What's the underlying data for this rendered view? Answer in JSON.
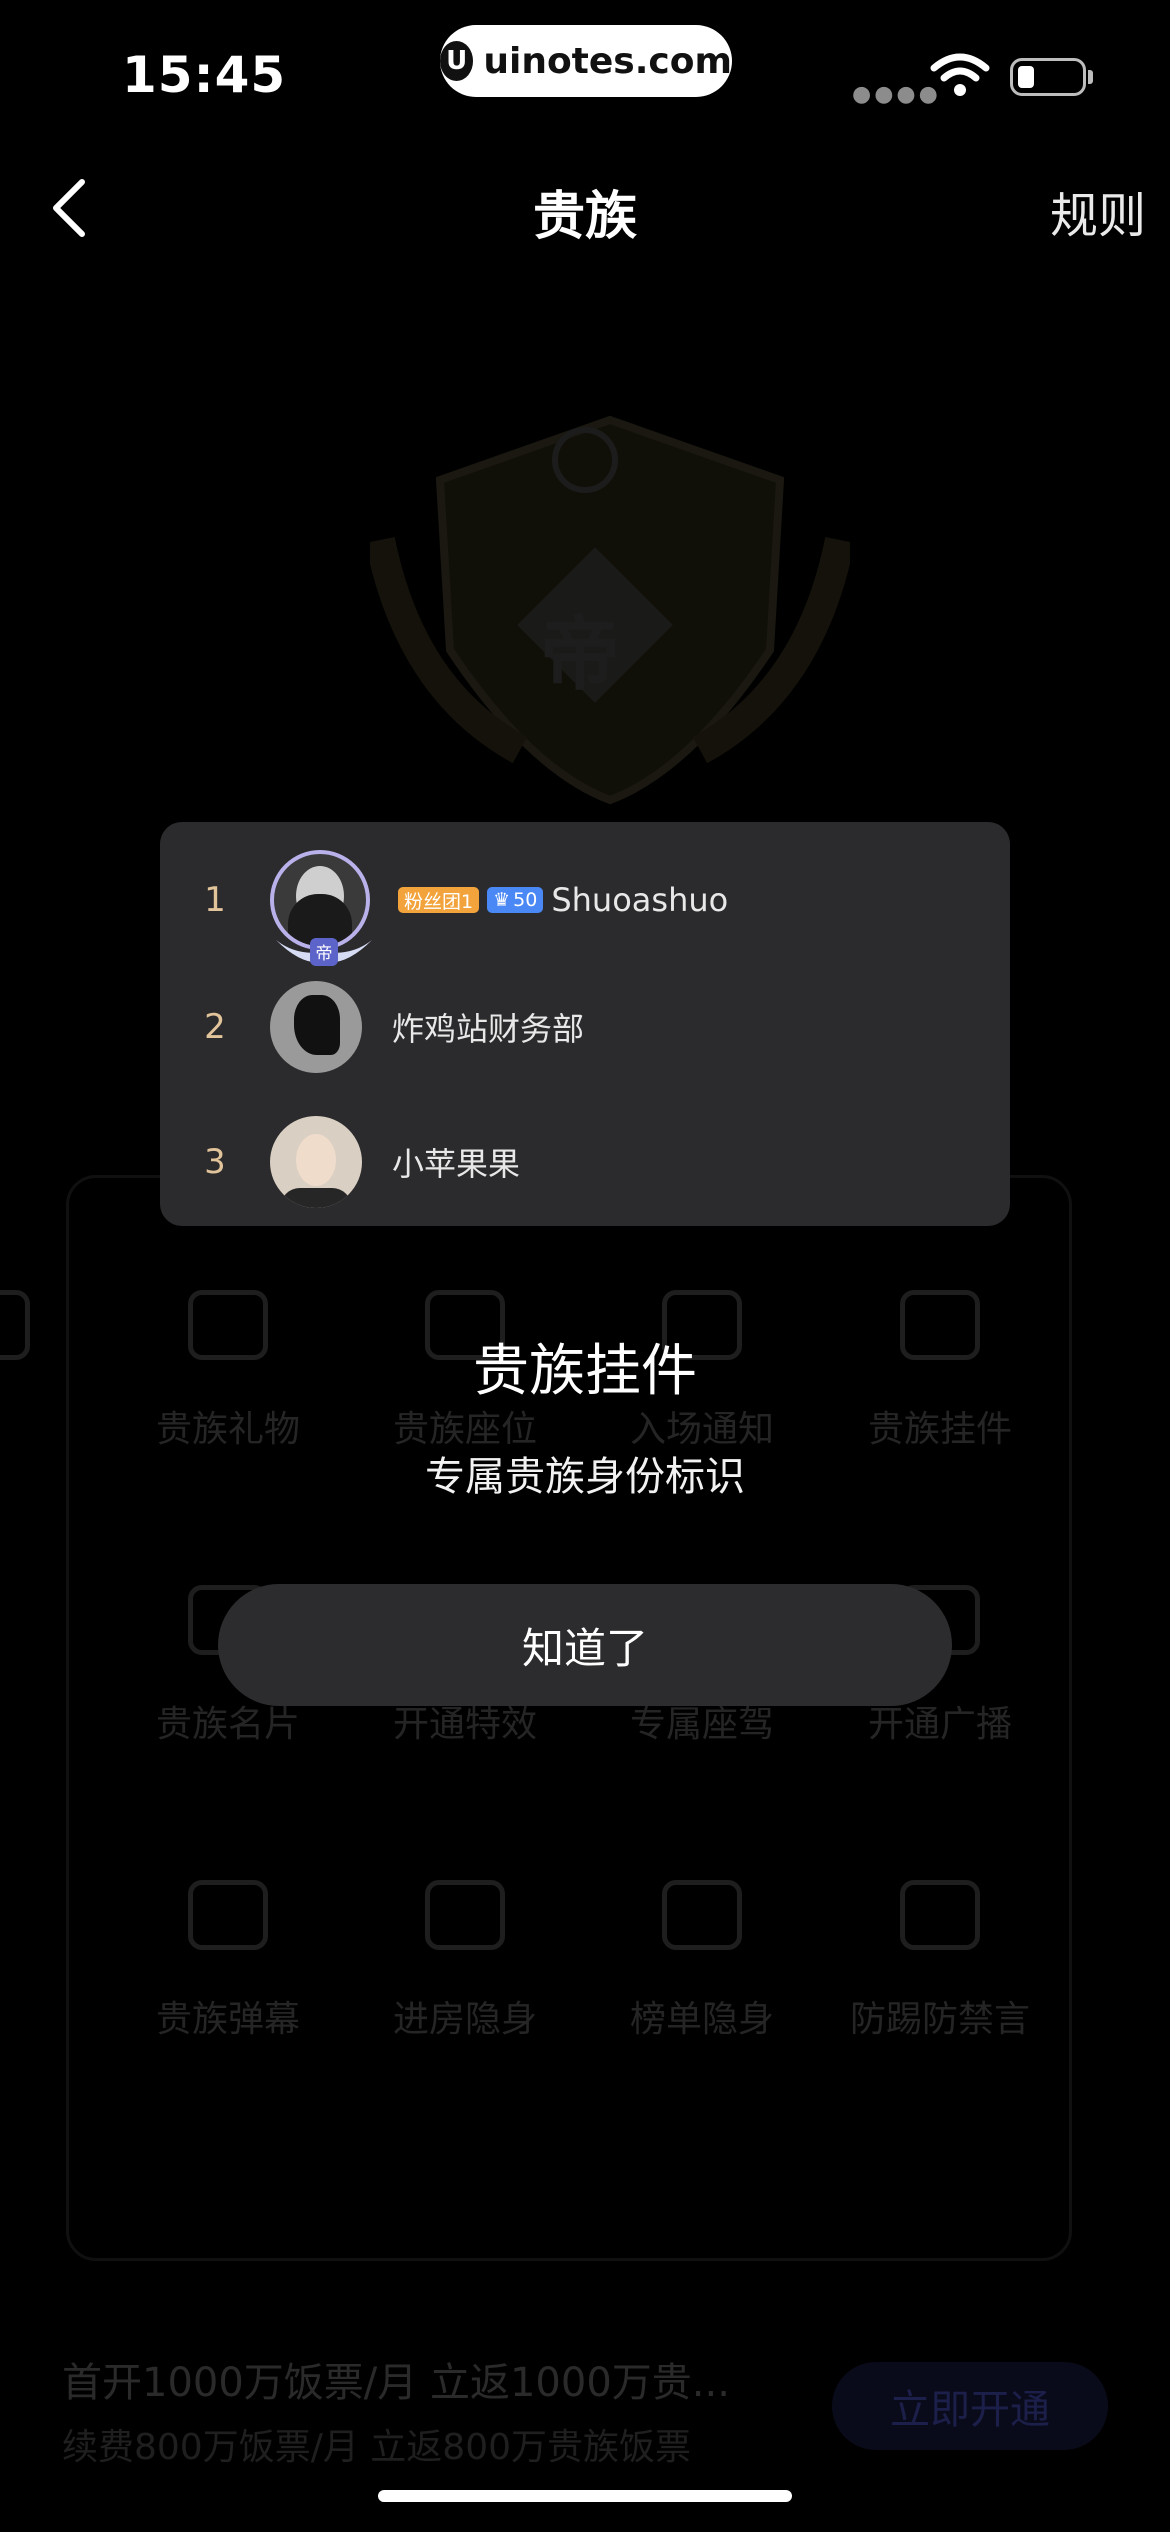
{
  "status_bar": {
    "time": "15:45",
    "url": "uinotes.com",
    "logo_letter": "U"
  },
  "nav": {
    "title": "贵族",
    "right_link": "规则"
  },
  "background": {
    "crest_text": "帝",
    "grid": [
      [
        "",
        "贵族礼物",
        "贵族座位",
        "入场通知",
        "贵族挂件"
      ],
      [
        "",
        "贵族名片",
        "开通特效",
        "专属座驾",
        "开通广播"
      ],
      [
        "",
        "贵族弹幕",
        "进房隐身",
        "榜单隐身",
        "防踢防禁言"
      ]
    ],
    "promo_line1": "首开1000万饭票/月 立返1000万贵...",
    "promo_line2": "续费800万饭票/月 立返800万贵族饭票",
    "open_button": "立即开通"
  },
  "card": {
    "rows": [
      {
        "rank": "1",
        "name": "Shuoashuo",
        "badge_fan": "粉丝团1",
        "badge_level": "50",
        "crest": "帝"
      },
      {
        "rank": "2",
        "name": "炸鸡站财务部"
      },
      {
        "rank": "3",
        "name": "小苹果果"
      }
    ]
  },
  "modal": {
    "title": "贵族挂件",
    "subtitle": "专属贵族身份标识",
    "confirm": "知道了"
  }
}
